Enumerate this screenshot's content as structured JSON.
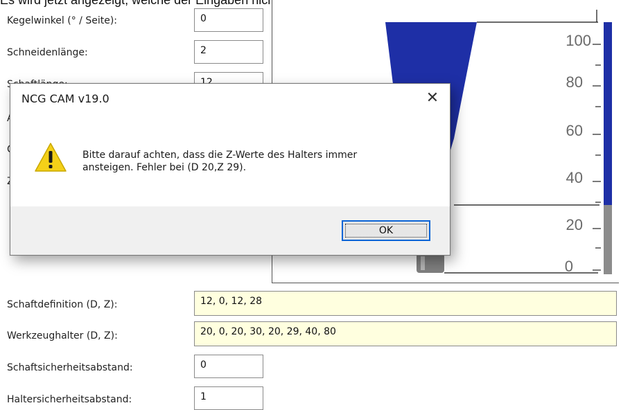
{
  "top_caption": "Es wird jetzt angezeigt, welche der Eingaben nicht korrekt ist.",
  "form": {
    "cone_angle": {
      "label": "Kegelwinkel (° / Seite):",
      "value": "0"
    },
    "cutting_length": {
      "label": "Schneidenlänge:",
      "value": "2"
    },
    "shank_height": {
      "label": "Schaftlänge:",
      "value": "12"
    },
    "shank_definition": {
      "label": "Schaftdefinition (D, Z):",
      "value": "12, 0, 12, 28"
    },
    "tool_holder": {
      "label": "Werkzeughalter (D, Z):",
      "value": "20, 0, 20, 30, 20, 29, 40, 80"
    },
    "shank_clearance": {
      "label": "Schaftsicherheitsabstand:",
      "value": "0"
    },
    "holder_clearance": {
      "label": "Haltersicherheitsabstand:",
      "value": "1"
    }
  },
  "hidden_labels": {
    "a": "A",
    "c": "C",
    "z": "Z"
  },
  "preview": {
    "ticks": [
      "100",
      "80",
      "60",
      "40",
      "20",
      "0"
    ],
    "colors": {
      "holder": "#1e2fa6",
      "shank": "#808080",
      "bar_blue": "#1e2fa6",
      "bar_gray": "#8c8c8c"
    }
  },
  "dialog": {
    "title": "NCG CAM v19.0",
    "message_line1": "Bitte darauf achten, dass die Z-Werte des Halters immer",
    "message_line2": "ansteigen. Fehler bei (D 20,Z 29).",
    "ok_label": "OK",
    "icon": "warning-icon"
  }
}
